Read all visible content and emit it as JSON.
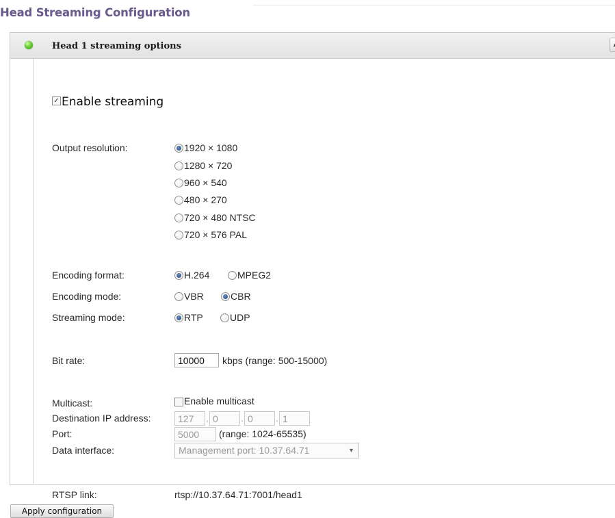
{
  "page_title": "Head Streaming Configuration",
  "panel": {
    "title": "Head 1 streaming options",
    "collapse_glyph": "▲"
  },
  "enable_streaming": {
    "label": "Enable streaming",
    "checked": true,
    "check_glyph": "✓"
  },
  "output_resolution": {
    "label": "Output resolution:",
    "options": [
      {
        "label": "1920 × 1080",
        "selected": true
      },
      {
        "label": "1280 × 720",
        "selected": false
      },
      {
        "label": "960 × 540",
        "selected": false
      },
      {
        "label": "480 × 270",
        "selected": false
      },
      {
        "label": "720 × 480 NTSC",
        "selected": false
      },
      {
        "label": "720 × 576 PAL",
        "selected": false
      }
    ]
  },
  "encoding_format": {
    "label": "Encoding format:",
    "options": [
      {
        "label": "H.264",
        "selected": true
      },
      {
        "label": "MPEG2",
        "selected": false
      }
    ]
  },
  "encoding_mode": {
    "label": "Encoding mode:",
    "options": [
      {
        "label": "VBR",
        "selected": false
      },
      {
        "label": "CBR",
        "selected": true
      }
    ]
  },
  "streaming_mode": {
    "label": "Streaming mode:",
    "options": [
      {
        "label": "RTP",
        "selected": true
      },
      {
        "label": "UDP",
        "selected": false
      }
    ]
  },
  "bit_rate": {
    "label": "Bit rate:",
    "value": "10000",
    "hint": "kbps (range: 500-15000)"
  },
  "multicast": {
    "label": "Multicast:",
    "checkbox_label": "Enable multicast",
    "checked": false
  },
  "destination_ip": {
    "label": "Destination IP address:",
    "octets": [
      "127",
      "0",
      "0",
      "1"
    ],
    "separator": "."
  },
  "port": {
    "label": "Port:",
    "value": "5000",
    "hint": "(range: 1024-65535)"
  },
  "data_interface": {
    "label": "Data interface:",
    "selected": "Management port: 10.37.64.71",
    "arrow_glyph": "▼"
  },
  "rtsp": {
    "label": "RTSP link:",
    "value": "rtsp://10.37.64.71:7001/head1"
  },
  "apply_button": {
    "label": "Apply configuration"
  },
  "colors": {
    "title": "#6a5a8e",
    "status_led": "#5cc22a",
    "radio_dot": "#1b3f7c"
  }
}
